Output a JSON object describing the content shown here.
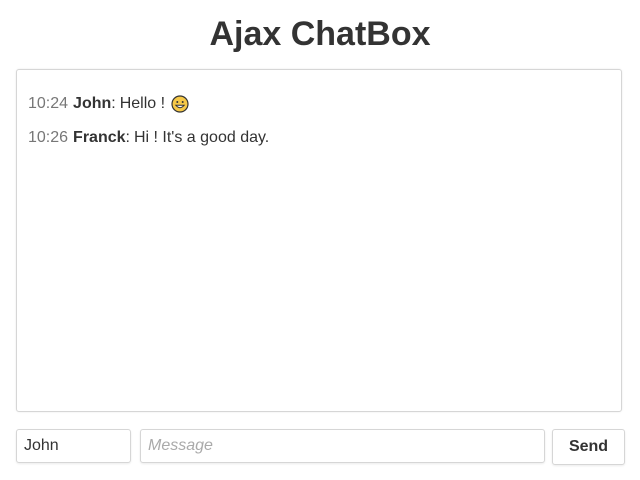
{
  "app": {
    "title": "Ajax ChatBox"
  },
  "messages": [
    {
      "time": "10:24",
      "author": "John",
      "separator": ":",
      "text": "Hello !",
      "emoji": "grinning-face-icon"
    },
    {
      "time": "10:26",
      "author": "Franck",
      "separator": ":",
      "text": "Hi ! It's a good day.",
      "emoji": null
    }
  ],
  "form": {
    "author_value": "John",
    "message_value": "",
    "message_placeholder": "Message",
    "send_label": "Send"
  },
  "colors": {
    "text": "#333333",
    "time": "#777777",
    "border": "#d6d6d6",
    "placeholder": "#aaaaaa",
    "emoji_fill": "#f7c948"
  }
}
